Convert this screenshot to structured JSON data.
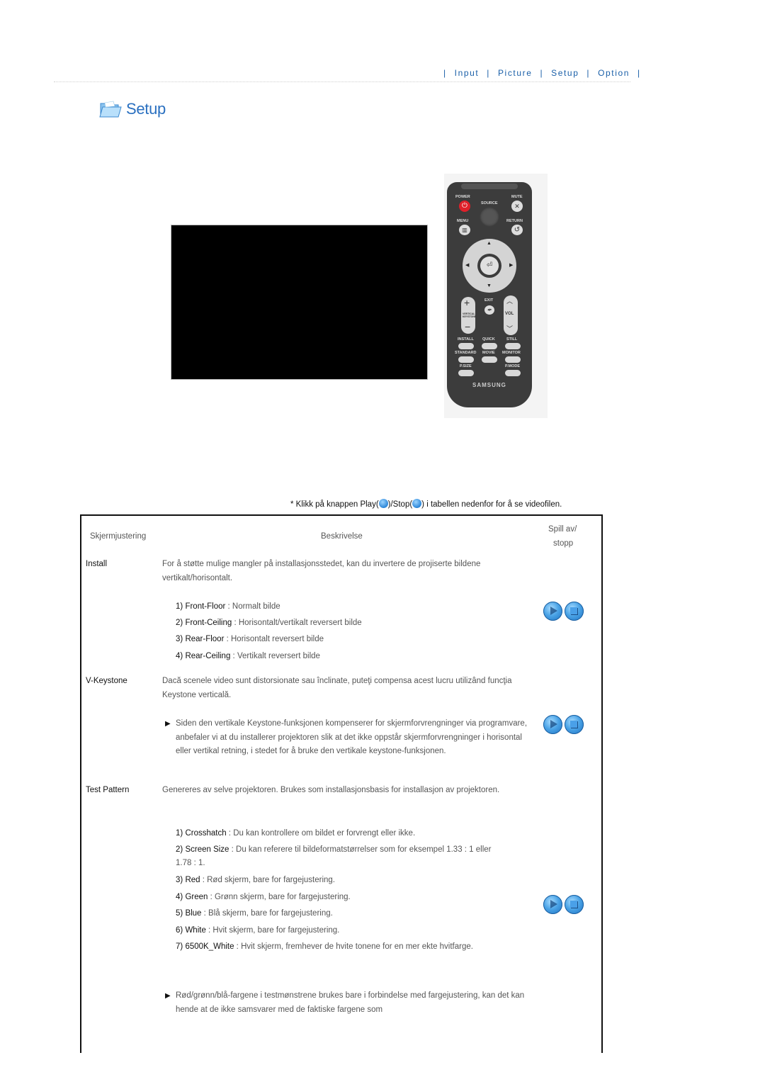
{
  "nav": {
    "items": [
      "Input",
      "Picture",
      "Setup",
      "Option"
    ]
  },
  "page": {
    "title": "Setup",
    "title_icon": "folder-icon"
  },
  "remote": {
    "brand": "SAMSUNG",
    "labels": {
      "power": "POWER",
      "source": "SOURCE",
      "mute": "MUTE",
      "menu": "MENU",
      "return": "RETURN",
      "exit": "EXIT",
      "vertical_keystone": "VERTICAL KEYSTONE",
      "vol": "VOL",
      "install": "INSTALL",
      "quick": "QUICK",
      "still": "STILL",
      "standard": "STANDARD",
      "movie": "MOVIE",
      "monitor": "MONITOR",
      "psize": "P.SIZE",
      "pmode": "P.MODE"
    }
  },
  "note": {
    "prefix": "* Klikk på knappen Play(",
    "middle": ")/Stop(",
    "suffix": ") i tabellen nedenfor for å se videofilen."
  },
  "table": {
    "headers": {
      "col1": "Skjermjustering",
      "col2": "Beskrivelse",
      "col3_line1": "Spill av/",
      "col3_line2": "stopp"
    },
    "rows": [
      {
        "name": "Install",
        "description": "For å støtte mulige mangler på installasjonsstedet, kan du invertere de projiserte bildene vertikalt/horisontalt.",
        "items": [
          {
            "num": "1)",
            "term": "Front-Floor",
            "text": " : Normalt bilde"
          },
          {
            "num": "2)",
            "term": "Front-Ceiling",
            "text": " : Horisontalt/vertikalt reversert bilde"
          },
          {
            "num": "3)",
            "term": "Rear-Floor",
            "text": " : Horisontalt reversert bilde"
          },
          {
            "num": "4)",
            "term": "Rear-Ceiling",
            "text": " : Vertikalt reversert bilde"
          }
        ]
      },
      {
        "name": "V-Keystone",
        "description": "Dacă scenele video sunt distorsionate sau înclinate, puteţi compensa acest lucru utilizând funcţia Keystone verticală.",
        "bullet": "Siden den vertikale Keystone-funksjonen kompenserer for skjermforvrengninger via programvare, anbefaler vi at du installerer projektoren slik at det ikke oppstår skjermforvrengninger i horisontal eller vertikal retning, i stedet for å bruke den vertikale keystone-funksjonen."
      },
      {
        "name": "Test Pattern",
        "description": "Genereres av selve projektoren. Brukes som installasjonsbasis for installasjon av projektoren.",
        "items": [
          {
            "num": "1)",
            "term": "Crosshatch",
            "text": " : Du kan kontrollere om bildet er forvrengt eller ikke."
          },
          {
            "num": "2)",
            "term": "Screen Size",
            "text": " : Du kan referere til bildeformatstørrelser som for eksempel 1.33 : 1 eller 1.78 : 1."
          },
          {
            "num": "3)",
            "term": "Red",
            "text": " : Rød skjerm, bare for fargejustering."
          },
          {
            "num": "4)",
            "term": "Green",
            "text": " : Grønn skjerm, bare for fargejustering."
          },
          {
            "num": "5)",
            "term": "Blue",
            "text": " : Blå skjerm, bare for fargejustering."
          },
          {
            "num": "6)",
            "term": "White",
            "text": " : Hvit skjerm, bare for fargejustering."
          },
          {
            "num": "7)",
            "term": "6500K_White",
            "text": " : Hvit skjerm, fremhever de hvite tonene for en mer ekte hvitfarge."
          }
        ],
        "bullet": "Rød/grønn/blå-fargene i testmønstrene brukes bare i forbindelse med fargejustering, kan det kan hende at de ikke samsvarer med de faktiske fargene som"
      }
    ]
  },
  "colors": {
    "nav_link": "#1a5fa8",
    "title": "#2a70c0",
    "play_button": "#4aa3e6",
    "power_button": "#e0202a"
  }
}
